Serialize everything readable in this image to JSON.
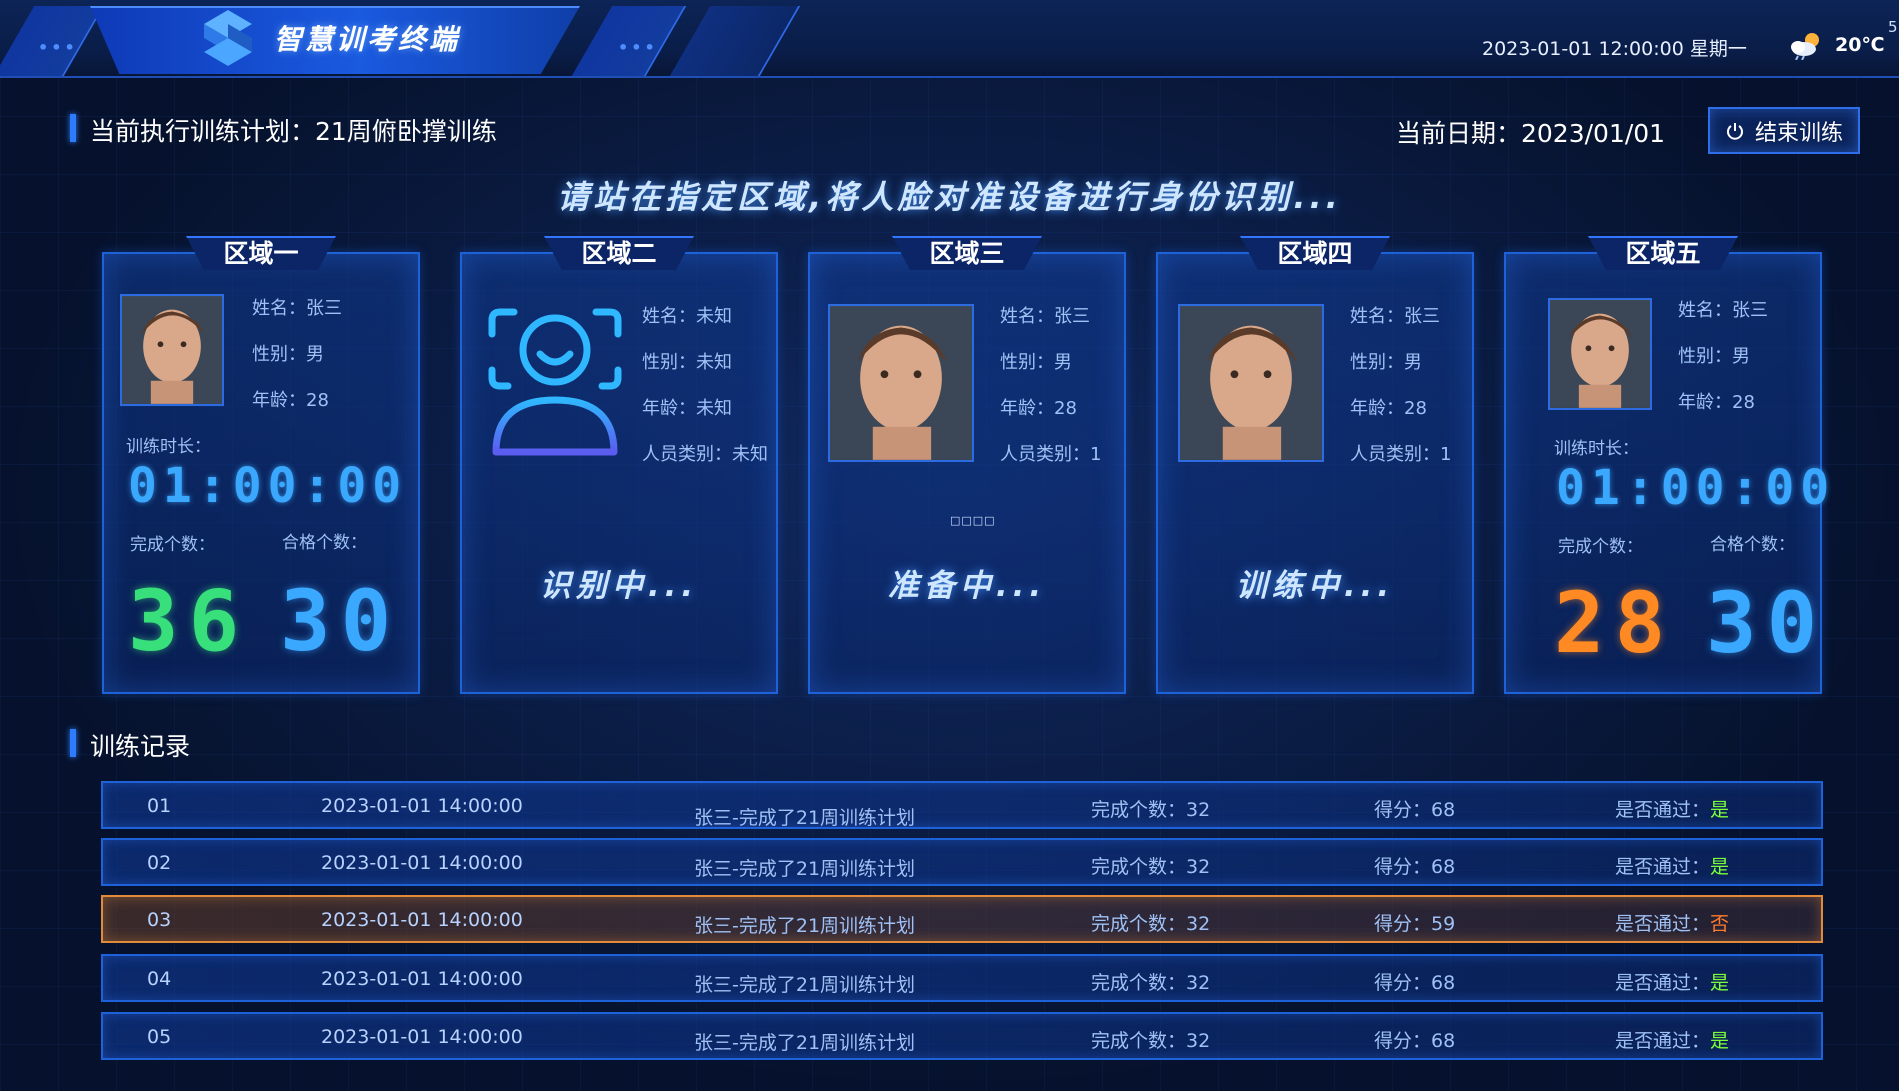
{
  "header": {
    "app_title": "智慧训考终端",
    "datetime": "2023-01-01 12:00:00 星期一",
    "temperature": "20℃",
    "weather_icon": "cloud-sun-icon",
    "corner_mark": "5"
  },
  "plan": {
    "current_plan": "当前执行训练计划：21周俯卧撑训练",
    "current_date": "当前日期：2023/01/01",
    "end_button_label": "结束训练"
  },
  "instruction": "请站在指定区域,将人脸对准设备进行身份识别...",
  "zones": [
    {
      "title": "区域一",
      "name": "姓名：张三",
      "gender": "性别：男",
      "age": "年龄：28",
      "timer_label": "训练时长：",
      "timer": "01:00:00",
      "completed_label": "完成个数：",
      "qualified_label": "合格个数：",
      "completed": "36",
      "qualified": "30"
    },
    {
      "title": "区域二",
      "name": "姓名：未知",
      "gender": "性别：未知",
      "age": "年龄：未知",
      "category": "人员类别：未知",
      "status": "识别中..."
    },
    {
      "title": "区域三",
      "name": "姓名：张三",
      "gender": "性别：男",
      "age": "年龄：28",
      "category": "人员类别：1",
      "marker": "□□□□",
      "status": "准备中..."
    },
    {
      "title": "区域四",
      "name": "姓名：张三",
      "gender": "性别：男",
      "age": "年龄：28",
      "category": "人员类别：1",
      "status": "训练中..."
    },
    {
      "title": "区域五",
      "name": "姓名：张三",
      "gender": "性别：男",
      "age": "年龄：28",
      "timer_label": "训练时长：",
      "timer": "01:00:00",
      "completed_label": "完成个数：",
      "qualified_label": "合格个数：",
      "completed": "28",
      "qualified": "30"
    }
  ],
  "records": {
    "title": "训练记录",
    "rows": [
      {
        "index": "01",
        "time": "2023-01-01 14:00:00",
        "desc": "张三-完成了21周训练计划",
        "count": "完成个数：32",
        "score": "得分：68",
        "pass_label": "是否通过：",
        "pass": "是"
      },
      {
        "index": "02",
        "time": "2023-01-01 14:00:00",
        "desc": "张三-完成了21周训练计划",
        "count": "完成个数：32",
        "score": "得分：68",
        "pass_label": "是否通过：",
        "pass": "是"
      },
      {
        "index": "03",
        "time": "2023-01-01 14:00:00",
        "desc": "张三-完成了21周训练计划",
        "count": "完成个数：32",
        "score": "得分：59",
        "pass_label": "是否通过：",
        "pass": "否"
      },
      {
        "index": "04",
        "time": "2023-01-01 14:00:00",
        "desc": "张三-完成了21周训练计划",
        "count": "完成个数：32",
        "score": "得分：68",
        "pass_label": "是否通过：",
        "pass": "是"
      },
      {
        "index": "05",
        "time": "2023-01-01 14:00:00",
        "desc": "张三-完成了21周训练计划",
        "count": "完成个数：32",
        "score": "得分：68",
        "pass_label": "是否通过：",
        "pass": "是"
      }
    ]
  },
  "colors": {
    "accent": "#2d7cff",
    "pass": "#7dff3a",
    "fail": "#ff7a2a",
    "digit_green": "#38e07c",
    "digit_blue": "#3aa8ff",
    "digit_orange": "#ff8a24"
  }
}
